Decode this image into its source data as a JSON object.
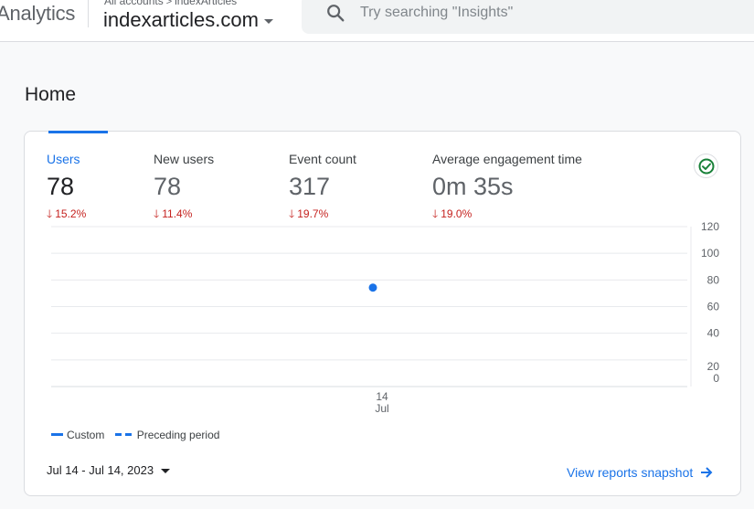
{
  "header": {
    "app_name": "Analytics",
    "breadcrumb": {
      "accounts": "All accounts",
      "separator": ">",
      "account": "indexArticles"
    },
    "property": "indexarticles.com",
    "search": {
      "placeholder": "Try searching \"Insights\"",
      "icon": "search-icon"
    }
  },
  "page": {
    "title": "Home"
  },
  "metrics": [
    {
      "label": "Users",
      "value": "78",
      "change": "15.2%",
      "direction": "down",
      "active": true
    },
    {
      "label": "New users",
      "value": "78",
      "change": "11.4%",
      "direction": "down",
      "active": false
    },
    {
      "label": "Event count",
      "value": "317",
      "change": "19.7%",
      "direction": "down",
      "active": false
    },
    {
      "label": "Average engagement time",
      "value": "0m 35s",
      "change": "19.0%",
      "direction": "down",
      "active": false
    }
  ],
  "status_icon": "check-circle-icon",
  "chart_data": {
    "type": "line",
    "x_tick_labels": [
      {
        "day": "14",
        "month": "Jul"
      }
    ],
    "y_ticks": [
      0,
      20,
      40,
      60,
      80,
      100,
      120
    ],
    "ylim": [
      0,
      120
    ],
    "series": [
      {
        "name": "Custom",
        "style": "solid",
        "x": [
          "Jul 14"
        ],
        "values": [
          78
        ]
      },
      {
        "name": "Preceding period",
        "style": "dashed",
        "x": [],
        "values": []
      }
    ],
    "legend_position": "bottom-left",
    "grid": true
  },
  "footer": {
    "date_range": "Jul 14 - Jul 14, 2023",
    "snapshot_link": "View reports snapshot"
  },
  "colors": {
    "accent": "#1a73e8",
    "negative": "#c5221f",
    "success": "#188038"
  }
}
